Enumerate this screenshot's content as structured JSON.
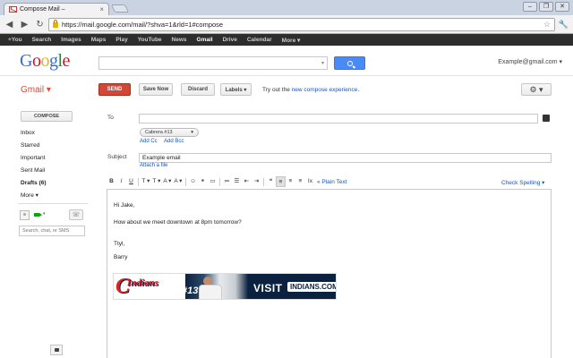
{
  "browser": {
    "tab_title": "Compose Mail –",
    "tab_close": "×",
    "url": "https://mail.google.com/mail/?shva=1&rld=1#compose",
    "window_buttons": [
      "–",
      "❐",
      "✕"
    ],
    "nav_back": "◀",
    "nav_forward": "▶",
    "nav_reload": "↻",
    "star": "☆",
    "wrench": "🔧"
  },
  "gbar": {
    "items": [
      "+You",
      "Search",
      "Images",
      "Maps",
      "Play",
      "YouTube",
      "News",
      "Gmail",
      "Drive",
      "Calendar",
      "More ▾"
    ],
    "active": "Gmail"
  },
  "header": {
    "logo_letters": [
      {
        "ch": "G",
        "color": "#3369e8"
      },
      {
        "ch": "o",
        "color": "#d50f25"
      },
      {
        "ch": "o",
        "color": "#eeb211"
      },
      {
        "ch": "g",
        "color": "#3369e8"
      },
      {
        "ch": "l",
        "color": "#009925"
      },
      {
        "ch": "e",
        "color": "#d50f25"
      }
    ],
    "search_value": "",
    "account": "Example@gmail.com ▾"
  },
  "actions": {
    "gmail_label": "Gmail ▾",
    "send": "SEND",
    "save_now": "Save Now",
    "discard": "Discard",
    "labels": "Labels ▾",
    "tryout_prefix": "Try out the ",
    "tryout_link": "new compose experience",
    "tryout_suffix": ".",
    "gear": "⚙ ▾"
  },
  "sidebar": {
    "compose": "COMPOSE",
    "items": [
      {
        "label": "Inbox",
        "bold": false
      },
      {
        "label": "Starred",
        "bold": false
      },
      {
        "label": "Important",
        "bold": false
      },
      {
        "label": "Sent Mail",
        "bold": false
      },
      {
        "label": "Drafts (6)",
        "bold": true
      },
      {
        "label": "More ▾",
        "bold": false
      }
    ],
    "video_caret": "▾",
    "phone": "☏",
    "chat_search_placeholder": "Search, chat, or SMS"
  },
  "compose": {
    "to_label": "To",
    "to_value": "",
    "from_value": "Cabrera #13",
    "from_caret": "▾",
    "add_cc": "Add Cc",
    "add_bcc": "Add Bcc",
    "subject_label": "Subject",
    "subject_value": "Example email",
    "attach": "Attach a file",
    "format_items": [
      "B",
      "I",
      "U",
      "T ▾",
      "T ▾",
      "A ▾",
      "A ▾",
      "☺",
      "⚭",
      "▭",
      "≔",
      "☰",
      "⇤",
      "⇥",
      "❝",
      "≡",
      "≡",
      "≡",
      "Ix"
    ],
    "plain_text": "« Plain Text",
    "check_spelling": "Check Spelling ▾",
    "body_lines": [
      "Hi Jake,",
      "How about we meet downtown at 8pm tomorrow?",
      "Ttyl,",
      "Barry"
    ]
  },
  "banner": {
    "c_letter": "C",
    "team": "Indians",
    "number": "#13",
    "visit": "VISIT",
    "site": "INDIANS.COM"
  }
}
